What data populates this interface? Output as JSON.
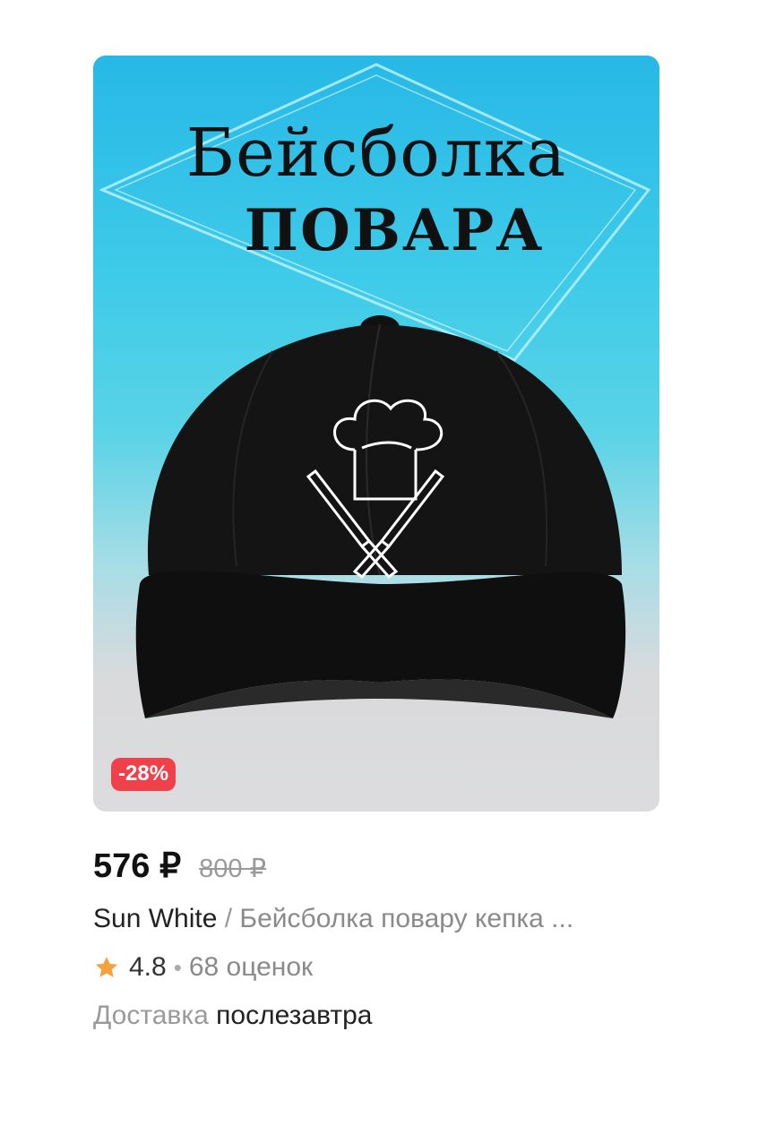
{
  "product": {
    "image": {
      "promo_line1": "Бейсболка",
      "promo_line2": "ПОВАРА",
      "icon": "baseball-cap-with-chef-hat-and-knives"
    },
    "discount_badge": "-28%",
    "price_current": "576 ₽",
    "price_old": "800 ₽",
    "brand": "Sun White",
    "separator": " / ",
    "name": "Бейсболка повару кепка ...",
    "rating": "4.8",
    "rating_separator": "•",
    "reviews": "68 оценок",
    "delivery_label": "Доставка",
    "delivery_value": "послезавтра"
  },
  "colors": {
    "badge": "#f0414b",
    "star": "#f6a13c",
    "background_top": "#27b8e6"
  }
}
